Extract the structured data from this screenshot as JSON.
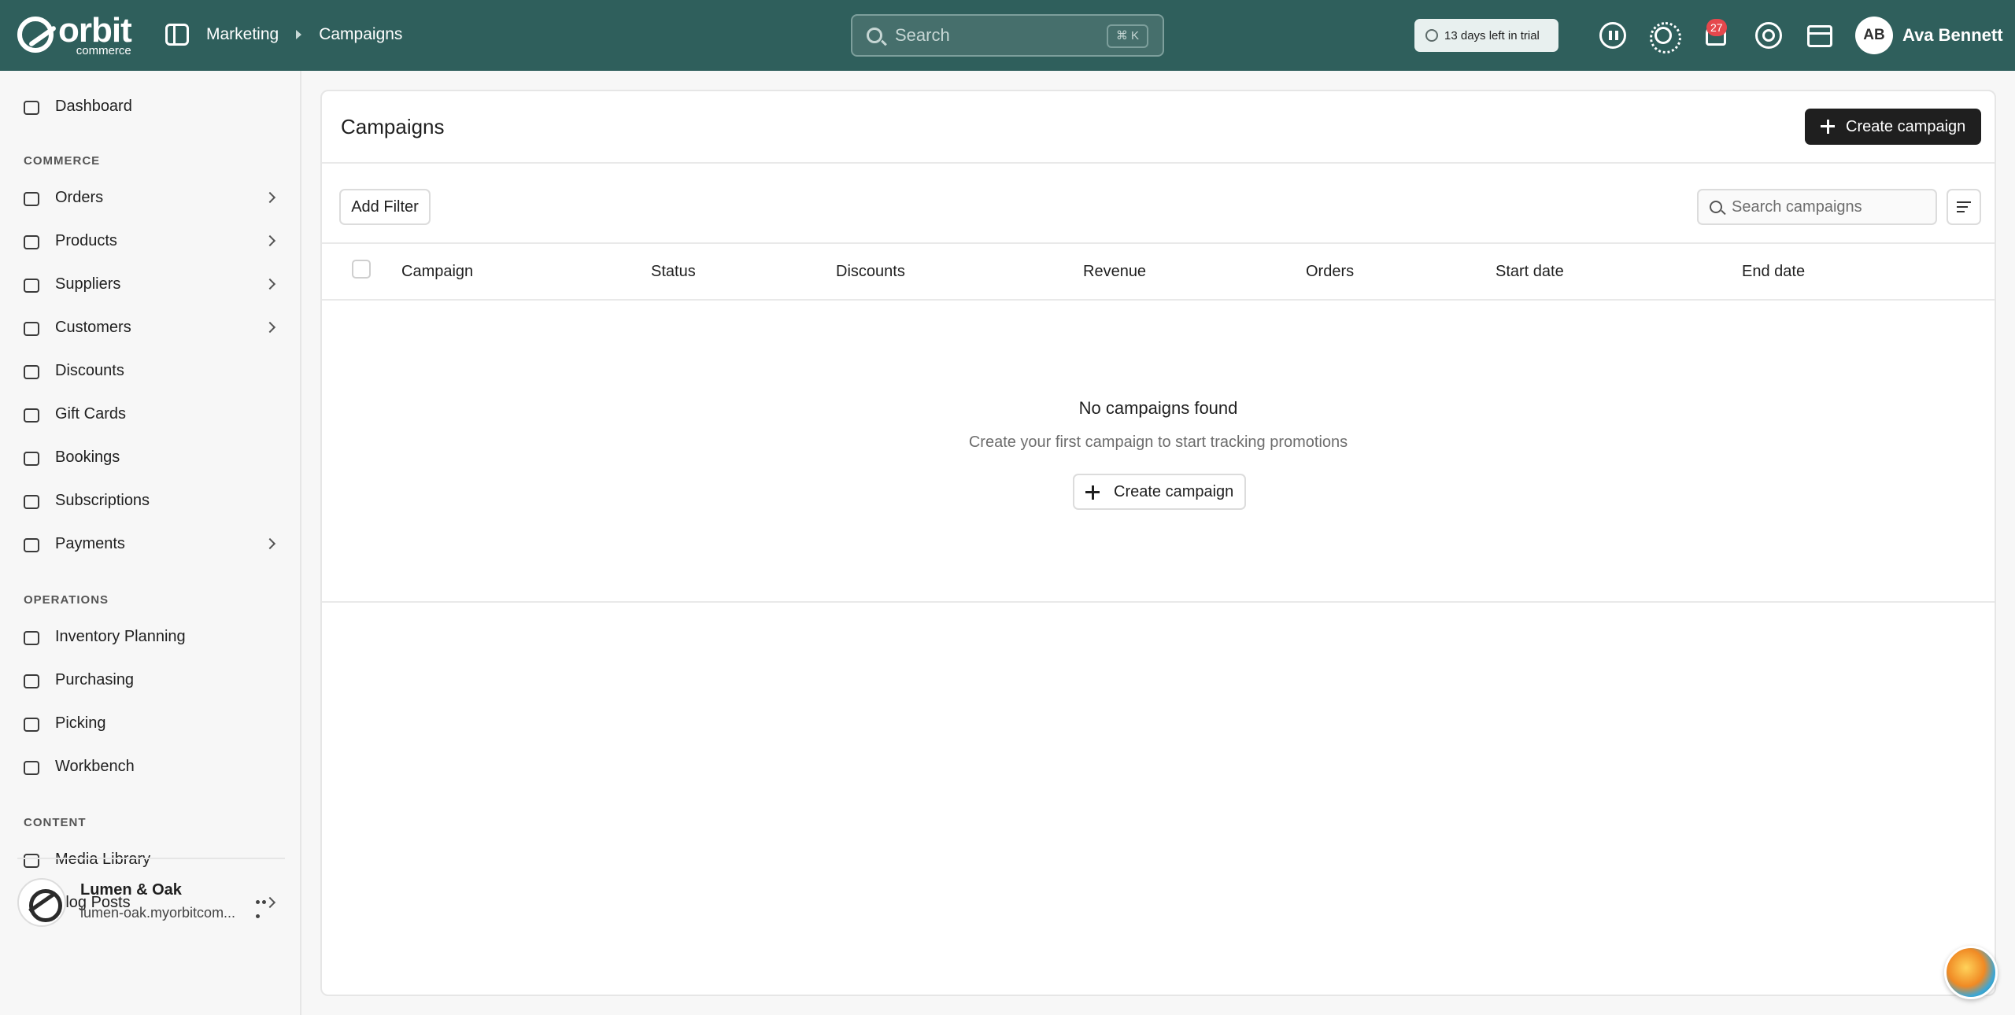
{
  "header": {
    "logo_word": "orbit",
    "logo_sub": "commerce",
    "breadcrumb": [
      "Marketing",
      "Campaigns"
    ],
    "search_placeholder": "Search",
    "search_shortcut": "⌘ K",
    "trial_badge": "13 days left in trial",
    "notification_count": "27",
    "user_initials": "AB",
    "user_name": "Ava Bennett"
  },
  "sidebar": {
    "dashboard": "Dashboard",
    "sections": {
      "commerce": "COMMERCE",
      "operations": "OPERATIONS",
      "content": "CONTENT"
    },
    "commerce_items": [
      {
        "label": "Orders",
        "icon": "orders-icon",
        "has_children": true
      },
      {
        "label": "Products",
        "icon": "box-icon",
        "has_children": true
      },
      {
        "label": "Suppliers",
        "icon": "truck-icon",
        "has_children": true
      },
      {
        "label": "Customers",
        "icon": "users-icon",
        "has_children": true
      },
      {
        "label": "Discounts",
        "icon": "tag-icon",
        "has_children": false
      },
      {
        "label": "Gift Cards",
        "icon": "gift-icon",
        "has_children": false
      },
      {
        "label": "Bookings",
        "icon": "calendar-icon",
        "has_children": false
      },
      {
        "label": "Subscriptions",
        "icon": "refresh-icon",
        "has_children": false
      },
      {
        "label": "Payments",
        "icon": "credit-card-icon",
        "has_children": true
      }
    ],
    "operations_items": [
      {
        "label": "Inventory Planning",
        "icon": "clipboard-icon"
      },
      {
        "label": "Purchasing",
        "icon": "package-icon"
      },
      {
        "label": "Picking",
        "icon": "map-pin-icon"
      },
      {
        "label": "Workbench",
        "icon": "cube-icon"
      }
    ],
    "content_items": [
      {
        "label": "Media Library",
        "icon": "image-icon",
        "has_children": false
      },
      {
        "label": "Blog Posts",
        "icon": "document-icon",
        "has_children": true
      }
    ],
    "workspace": {
      "name": "Lumen & Oak",
      "url": "lumen-oak.myorbitcom..."
    }
  },
  "main": {
    "title": "Campaigns",
    "create_button": "Create campaign",
    "add_filter": "Add Filter",
    "search_placeholder": "Search campaigns",
    "columns": [
      "Campaign",
      "Status",
      "Discounts",
      "Revenue",
      "Orders",
      "Start date",
      "End date"
    ],
    "empty_title": "No campaigns found",
    "empty_subtitle": "Create your first campaign to start tracking promotions",
    "empty_button": "Create campaign"
  },
  "colors": {
    "header_bg": "#2f5f5c",
    "primary_button": "#1f1f1f",
    "badge": "#e5484d"
  }
}
